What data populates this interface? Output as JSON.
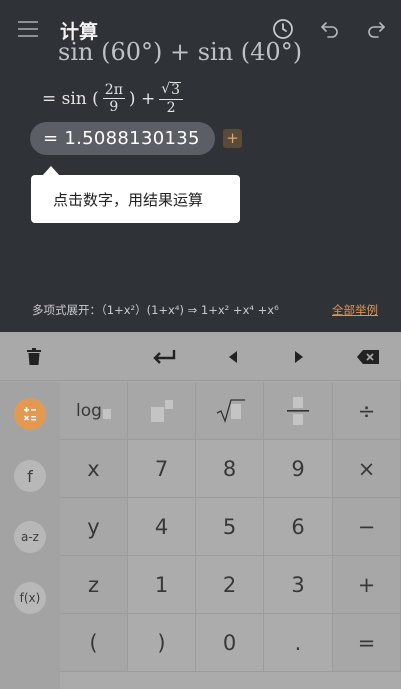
{
  "header": {
    "title": "计算",
    "icons": [
      "menu-icon",
      "history-icon",
      "undo-icon",
      "redo-icon"
    ]
  },
  "display": {
    "expression": "sin (60°) + sin (40°)",
    "formula": {
      "prefix": "= sin (",
      "frac1_num": "2π",
      "frac1_den": "9",
      "mid": ") +",
      "sqrt_val": "3",
      "frac2_den": "2"
    },
    "result": "= 1.5088130135",
    "plus_label": "+",
    "tooltip": "点击数字，用结果运算"
  },
  "hint": {
    "text": "多项式展开：（1+x²）(1+x⁴) ⇒ 1+x² +x⁴ +x⁶",
    "link": "全部举例"
  },
  "toolbar": {
    "icons": [
      "trash-icon",
      "enter-icon",
      "left-arrow-icon",
      "right-arrow-icon",
      "backspace-icon"
    ]
  },
  "side": {
    "items": [
      {
        "label": "",
        "name": "calculator-mode-icon"
      },
      {
        "label": "f",
        "name": "function-mode-button"
      },
      {
        "label": "a-z",
        "name": "letters-mode-button"
      },
      {
        "label": "f(x)",
        "name": "fx-mode-button"
      }
    ]
  },
  "keys": {
    "row0": [
      "log",
      "",
      "",
      "",
      "÷"
    ],
    "row1": [
      "x",
      "7",
      "8",
      "9",
      "×"
    ],
    "row2": [
      "y",
      "4",
      "5",
      "6",
      "−"
    ],
    "row3": [
      "z",
      "1",
      "2",
      "3",
      "+"
    ],
    "row4": [
      "(",
      ")",
      "0",
      ".",
      "="
    ]
  },
  "colors": {
    "accent": "#e29a52",
    "link": "#e0954f",
    "display_bg": "#2f3236",
    "keyboard_bg": "#ababab"
  }
}
